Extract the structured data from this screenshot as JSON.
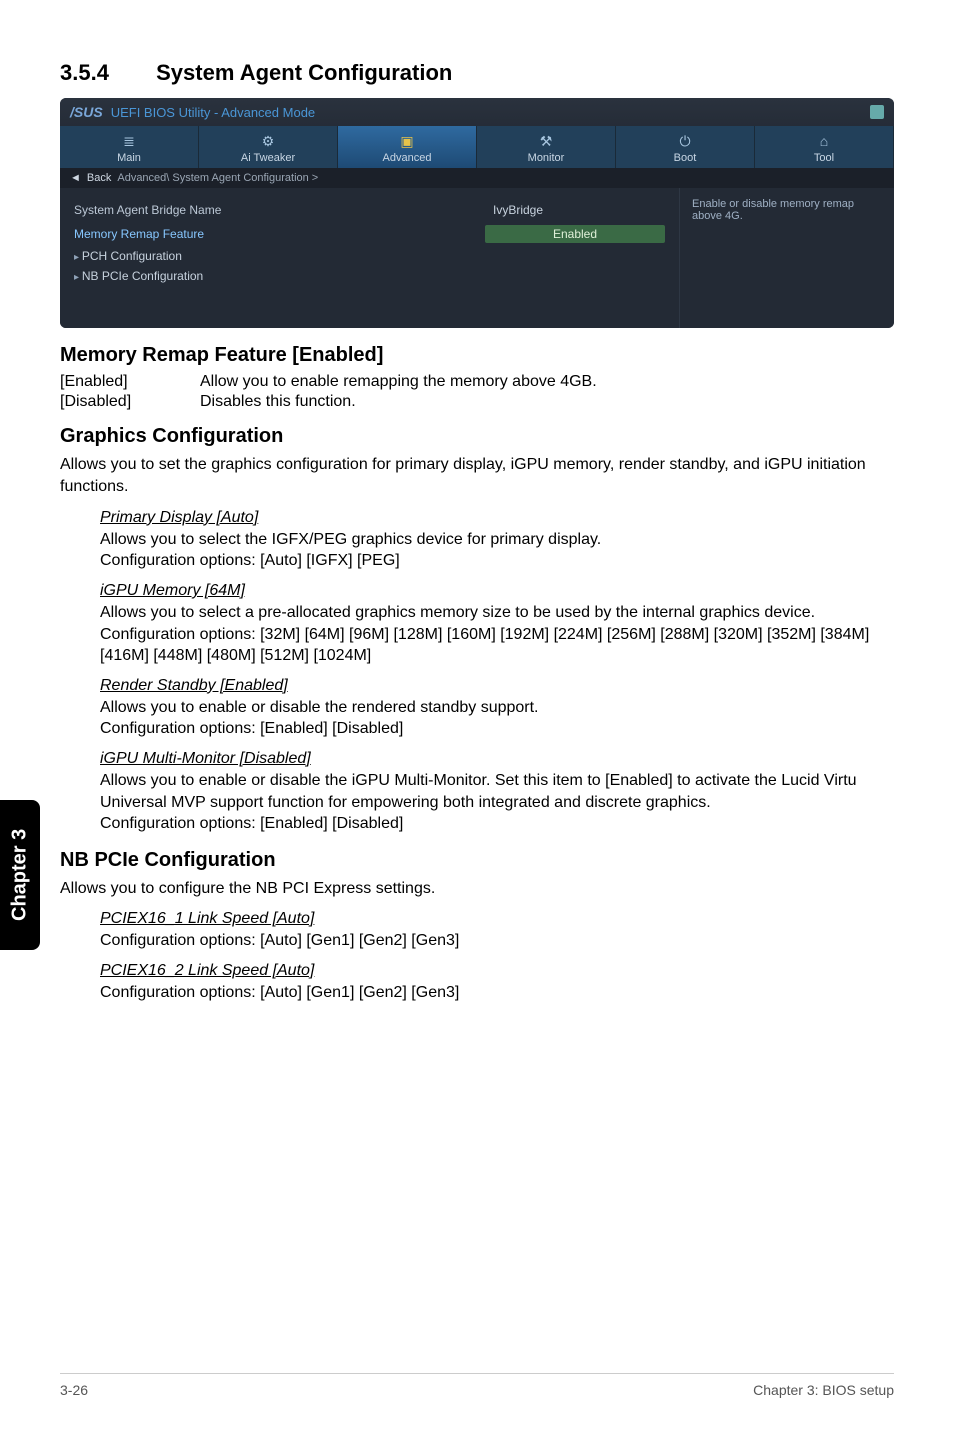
{
  "side_tab": "Chapter 3",
  "section": {
    "number": "3.5.4",
    "title": "System Agent Configuration"
  },
  "bios": {
    "logo": "/SUS",
    "title": "UEFI BIOS Utility - Advanced Mode",
    "tabs": [
      {
        "icon": "list-icon",
        "glyph": "≣",
        "label": "Main"
      },
      {
        "icon": "dial-icon",
        "glyph": "⚙",
        "label": "Ai Tweaker"
      },
      {
        "icon": "chip-icon",
        "glyph": "▣",
        "label": "Advanced",
        "active": true
      },
      {
        "icon": "wrench-icon",
        "glyph": "⚒",
        "label": "Monitor"
      },
      {
        "icon": "power-icon",
        "glyph": "⏻",
        "label": "Boot"
      },
      {
        "icon": "toolbox-icon",
        "glyph": "⌂",
        "label": "Tool"
      }
    ],
    "breadcrumb": {
      "back": "Back",
      "path": "Advanced\\ System Agent Configuration >"
    },
    "rows": [
      {
        "name": "System Agent Bridge Name",
        "value": "IvyBridge",
        "type": "info"
      },
      {
        "name": "Memory Remap Feature",
        "value": "Enabled",
        "type": "select",
        "selected": true
      },
      {
        "name": "PCH Configuration",
        "type": "link"
      },
      {
        "name": "NB PCIe Configuration",
        "type": "link"
      }
    ],
    "help": "Enable or disable memory remap above 4G."
  },
  "memory_remap": {
    "heading": "Memory Remap Feature [Enabled]",
    "opts": [
      {
        "k": "[Enabled]",
        "v": "Allow you to enable remapping the memory above 4GB."
      },
      {
        "k": "[Disabled]",
        "v": "Disables this function."
      }
    ]
  },
  "graphics": {
    "heading": "Graphics Configuration",
    "desc": "Allows you to set the graphics configuration for primary display, iGPU memory, render standby, and iGPU initiation functions.",
    "items": [
      {
        "t": "Primary Display [Auto]",
        "lines": [
          "Allows you to select the IGFX/PEG graphics device for primary display.",
          "Configuration options: [Auto] [IGFX] [PEG]"
        ]
      },
      {
        "t": "iGPU Memory [64M]",
        "lines": [
          "Allows you to select a pre-allocated graphics memory size to be used by the internal graphics device.",
          "Configuration options: [32M] [64M] [96M] [128M] [160M] [192M] [224M] [256M] [288M] [320M] [352M] [384M] [416M] [448M] [480M] [512M] [1024M]"
        ]
      },
      {
        "t": "Render Standby [Enabled]",
        "lines": [
          "Allows you to enable or disable the rendered standby support.",
          "Configuration options: [Enabled] [Disabled]"
        ]
      },
      {
        "t": "iGPU Multi-Monitor [Disabled]",
        "lines": [
          "Allows you to enable or disable the iGPU Multi-Monitor. Set this item to [Enabled] to activate the Lucid Virtu Universal MVP support function for empowering both integrated and discrete graphics.",
          "Configuration options: [Enabled] [Disabled]"
        ]
      }
    ]
  },
  "nbpcie": {
    "heading": "NB PCIe Configuration",
    "desc": "Allows you to configure the NB PCI Express settings.",
    "items": [
      {
        "t": "PCIEX16_1 Link Speed [Auto]",
        "lines": [
          "Configuration options: [Auto] [Gen1] [Gen2] [Gen3]"
        ]
      },
      {
        "t": "PCIEX16_2 Link Speed [Auto]",
        "lines": [
          "Configuration options: [Auto] [Gen1] [Gen2] [Gen3]"
        ]
      }
    ]
  },
  "footer": {
    "left": "3-26",
    "right": "Chapter 3: BIOS setup"
  }
}
